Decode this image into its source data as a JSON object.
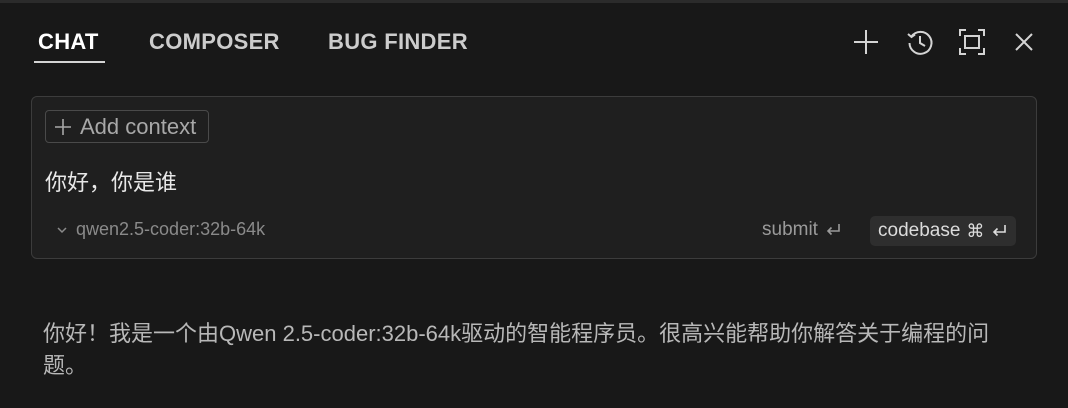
{
  "tabs": {
    "chat": "CHAT",
    "composer": "COMPOSER",
    "bug_finder": "BUG FINDER"
  },
  "actions": {
    "new_chat_icon": "plus-icon",
    "history_icon": "history-icon",
    "maximize_icon": "maximize-icon",
    "close_icon": "close-icon"
  },
  "input": {
    "add_context_label": "Add context",
    "message": "你好，你是谁",
    "model": "qwen2.5-coder:32b-64k",
    "submit_label": "submit",
    "codebase_label": "codebase"
  },
  "response": {
    "text": "你好！我是一个由Qwen 2.5-coder:32b-64k驱动的智能程序员。很高兴能帮助你解答关于编程的问题。"
  },
  "colors": {
    "background": "#181818",
    "input_background": "#1f1f1f",
    "border": "#3c3c3c"
  }
}
